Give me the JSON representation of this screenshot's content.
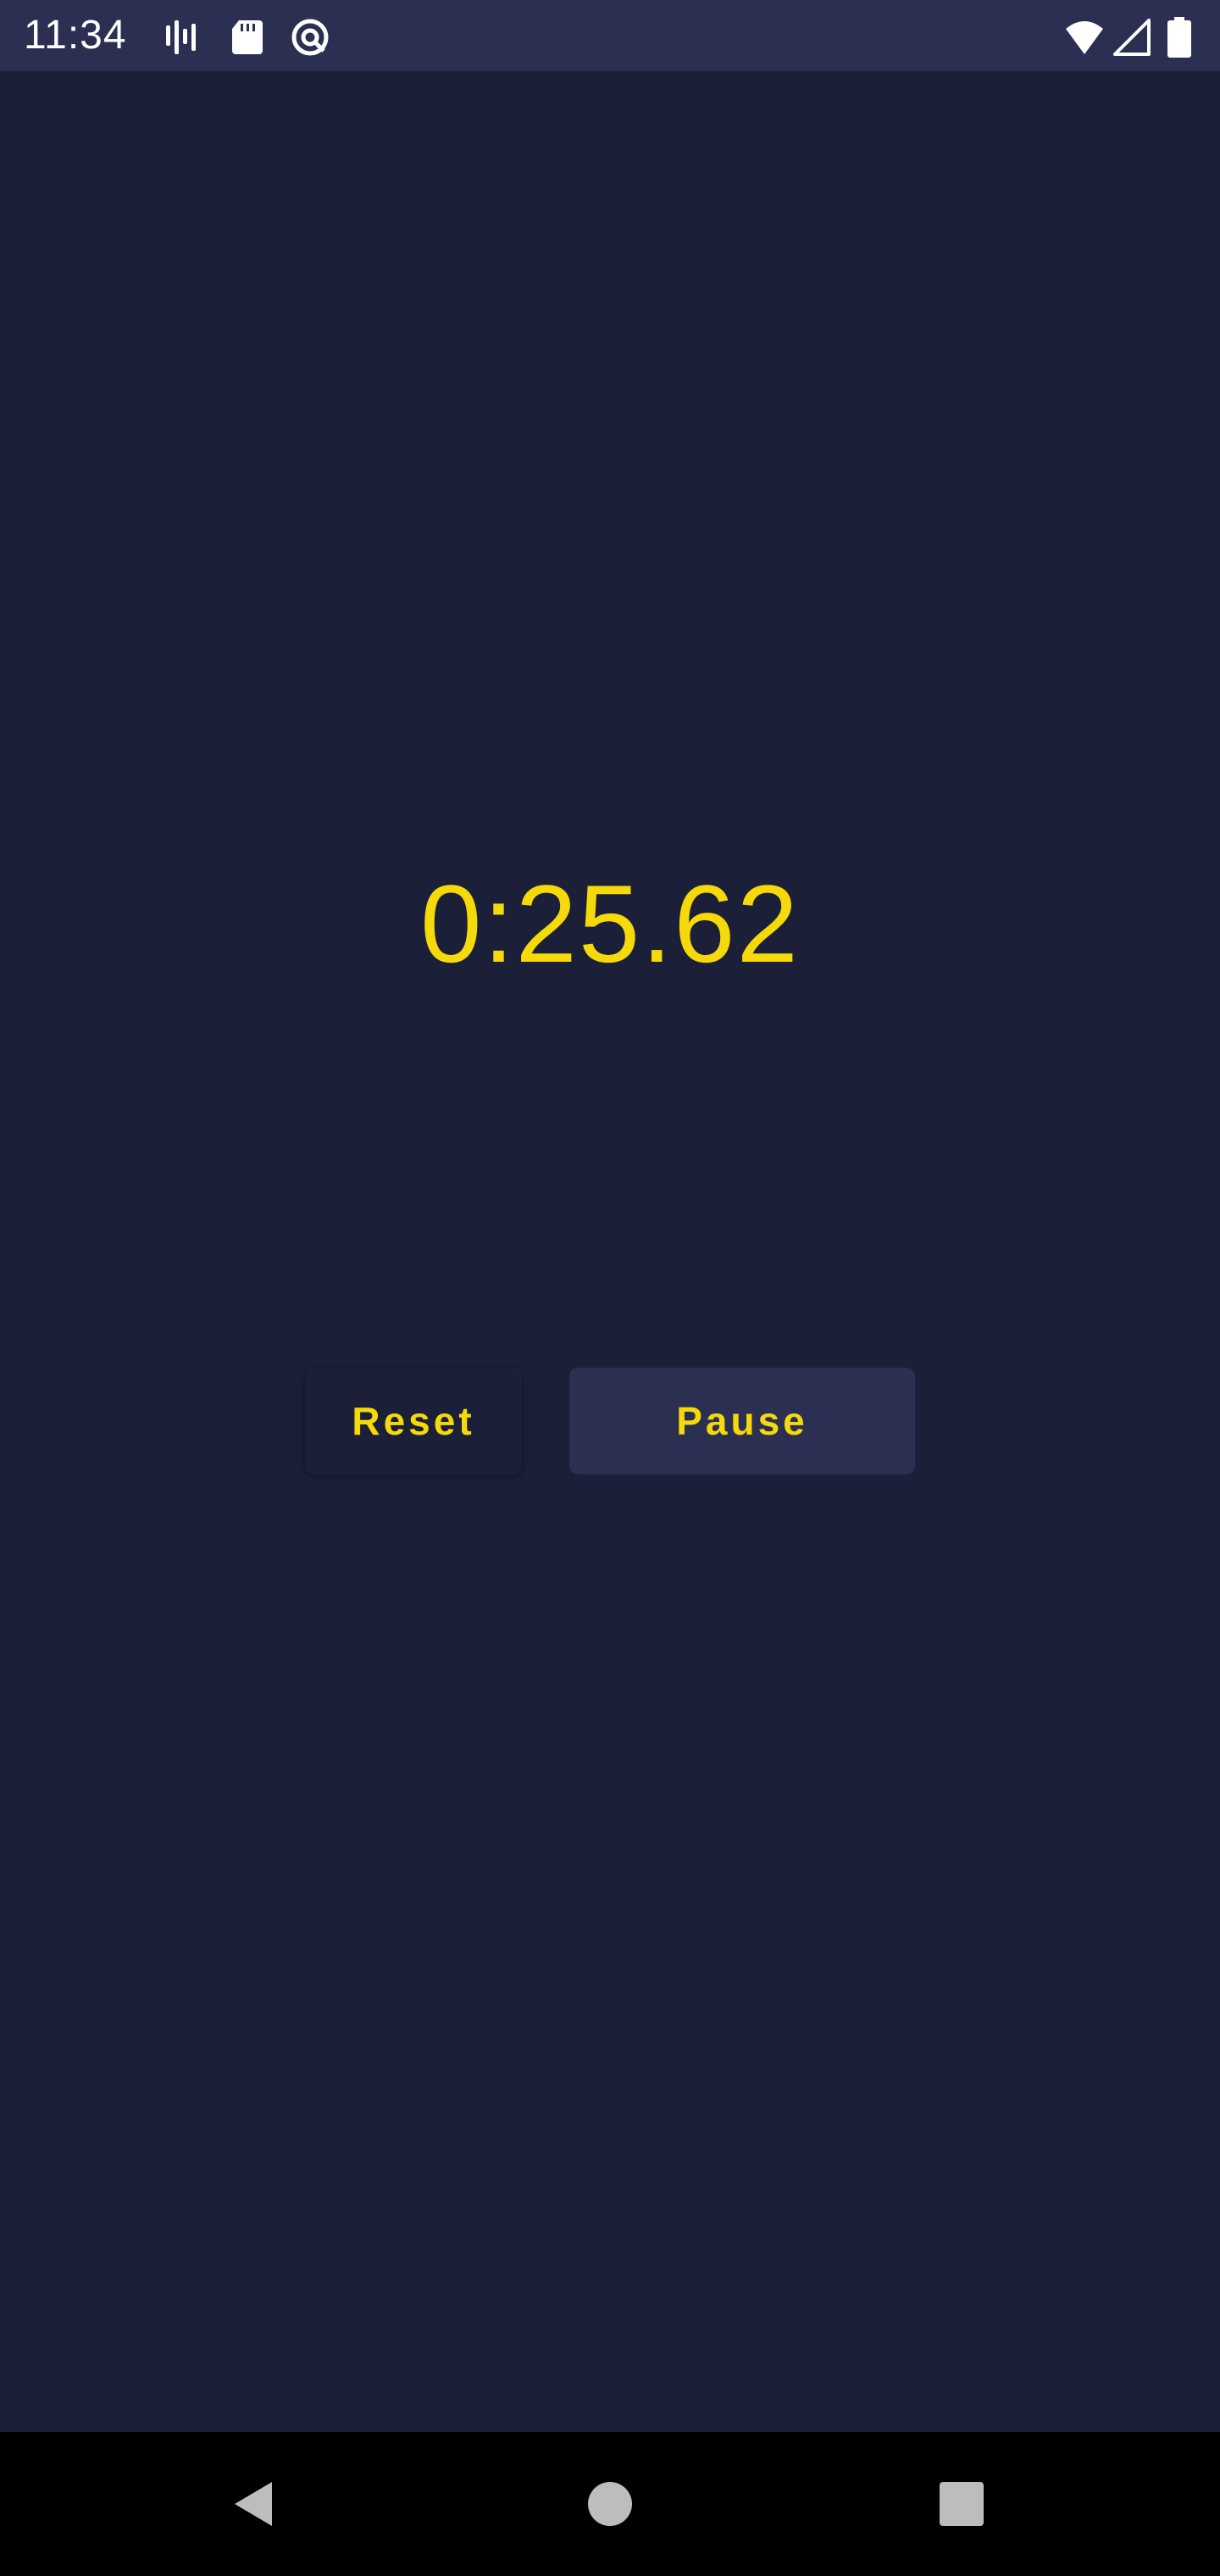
{
  "status_bar": {
    "time": "11:34",
    "icons": [
      "activity-icon",
      "sd-card-icon",
      "data-saver-icon",
      "wifi-icon",
      "cell-signal-icon",
      "battery-icon"
    ]
  },
  "stopwatch": {
    "time": "0:25.62",
    "reset_label": "Reset",
    "pause_label": "Pause"
  },
  "nav_bar": {
    "buttons": [
      "back-icon",
      "home-icon",
      "recents-icon"
    ]
  },
  "colors": {
    "background": "#1b1f38",
    "status_bar": "#2b2f52",
    "accent": "#f5d90a",
    "pause_button": "#2b2f52",
    "nav_bar": "#000000"
  }
}
